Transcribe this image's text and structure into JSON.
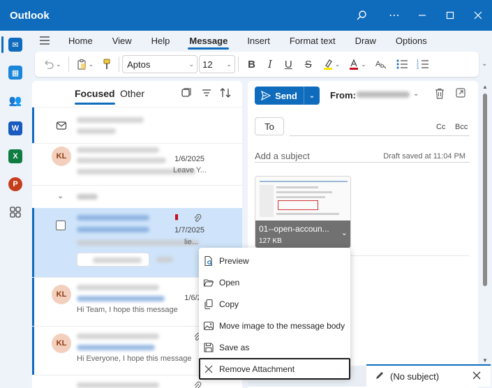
{
  "app": {
    "title": "Outlook"
  },
  "titlebar": {
    "search_icon": "search-icon",
    "more_icon": "more-icon"
  },
  "ribbon": {
    "tabs": [
      {
        "label": "Home"
      },
      {
        "label": "View"
      },
      {
        "label": "Help"
      },
      {
        "label": "Message"
      },
      {
        "label": "Insert"
      },
      {
        "label": "Format text"
      },
      {
        "label": "Draw"
      },
      {
        "label": "Options"
      }
    ],
    "active_tab": "Message",
    "font_name": "Aptos",
    "font_size": "12"
  },
  "list": {
    "pivots": {
      "focused": "Focused",
      "other": "Other"
    },
    "items": [
      {
        "avatar": "",
        "date": "",
        "preview_tail": ""
      },
      {
        "avatar": "KL",
        "date": "1/6/2025",
        "preview_tail": "Leave Y..."
      },
      {
        "avatar": "",
        "date": "1/7/2025",
        "preview_tail": "lie..."
      },
      {
        "avatar": "KL",
        "date": "1/6/202",
        "preview_tail": "Hi Team, I hope this message"
      },
      {
        "avatar": "KL",
        "date": "",
        "preview_tail": "Hi Everyone, I hope this message"
      }
    ]
  },
  "compose": {
    "send_label": "Send",
    "from_label": "From:",
    "to_label": "To",
    "cc_label": "Cc",
    "bcc_label": "Bcc",
    "subject_placeholder": "Add a subject",
    "draft_saved": "Draft saved at 11:04 PM",
    "attachment": {
      "name": "01--open-accoun...",
      "size": "127 KB"
    }
  },
  "context_menu": {
    "items": [
      {
        "label": "Preview",
        "icon": "preview-icon"
      },
      {
        "label": "Open",
        "icon": "open-folder-icon"
      },
      {
        "label": "Copy",
        "icon": "copy-icon"
      },
      {
        "label": "Move image to the message body",
        "icon": "image-icon"
      },
      {
        "label": "Save as",
        "icon": "save-icon"
      },
      {
        "label": "Remove Attachment",
        "icon": "close-icon"
      }
    ],
    "focused_item": "Remove Attachment"
  },
  "draft_tab": {
    "label": "(No subject)"
  },
  "colors": {
    "accent": "#0f6cbd",
    "selected_row": "#cfe4fa",
    "avatar_bg": "#f3d0be"
  }
}
